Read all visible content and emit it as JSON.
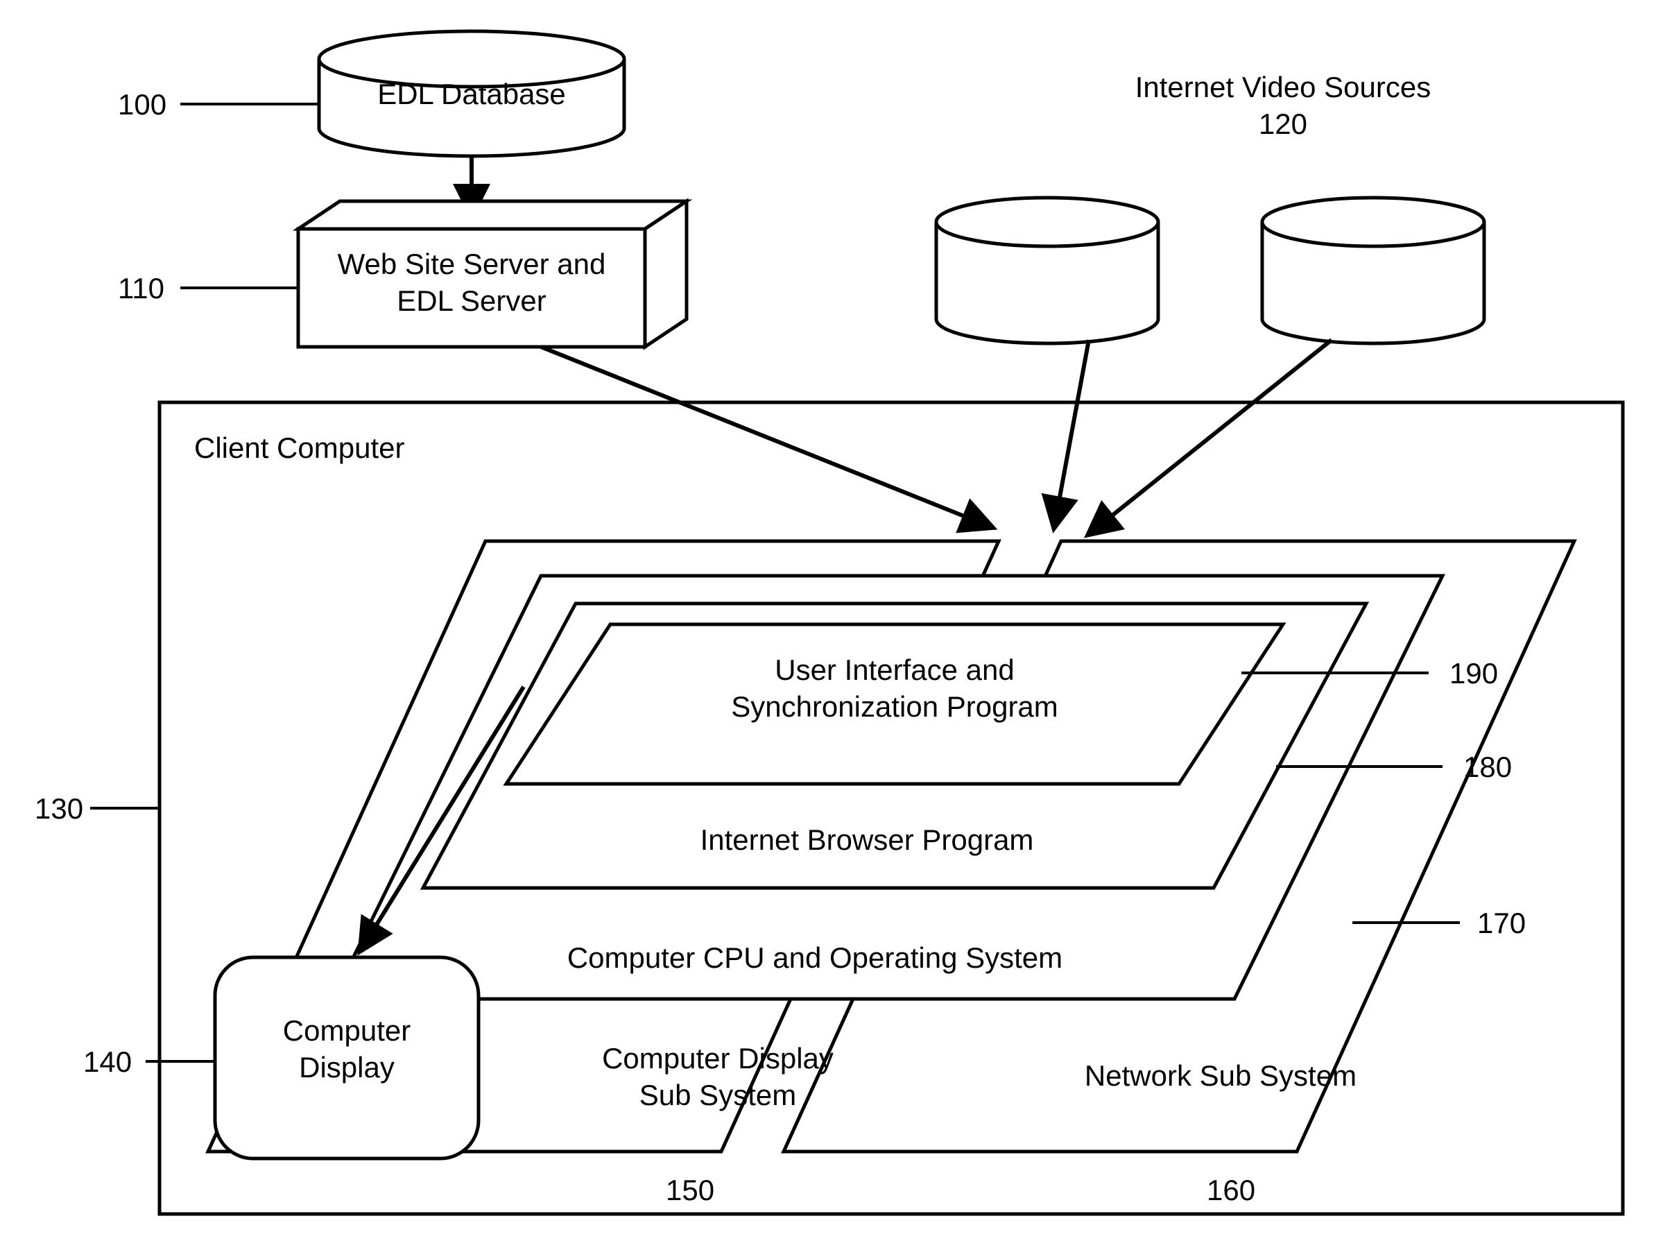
{
  "nodes": {
    "edl_db": {
      "ref": "100",
      "label": "EDL Database"
    },
    "web_server": {
      "ref": "110",
      "label": "Web Site Server and\nEDL Server"
    },
    "video_sources": {
      "ref": "120",
      "label": "Internet Video Sources\n120"
    },
    "client": {
      "ref": "130",
      "label": "Client Computer"
    },
    "display": {
      "ref": "140",
      "label": "Computer\nDisplay"
    },
    "disp_sub": {
      "ref": "150",
      "label": "Computer Display\nSub System"
    },
    "net_sub": {
      "ref": "160",
      "label": "Network Sub System"
    },
    "cpu_os": {
      "ref": "170",
      "label": "Computer CPU and Operating System"
    },
    "browser": {
      "ref": "180",
      "label": "Internet Browser Program"
    },
    "ui_sync": {
      "ref": "190",
      "label": "User Interface and\nSynchronization Program"
    }
  },
  "ref_labels": {
    "r100": "100",
    "r110": "110",
    "r130": "130",
    "r140": "140",
    "r150": "150",
    "r160": "160",
    "r170": "170",
    "r180": "180",
    "r190": "190"
  }
}
